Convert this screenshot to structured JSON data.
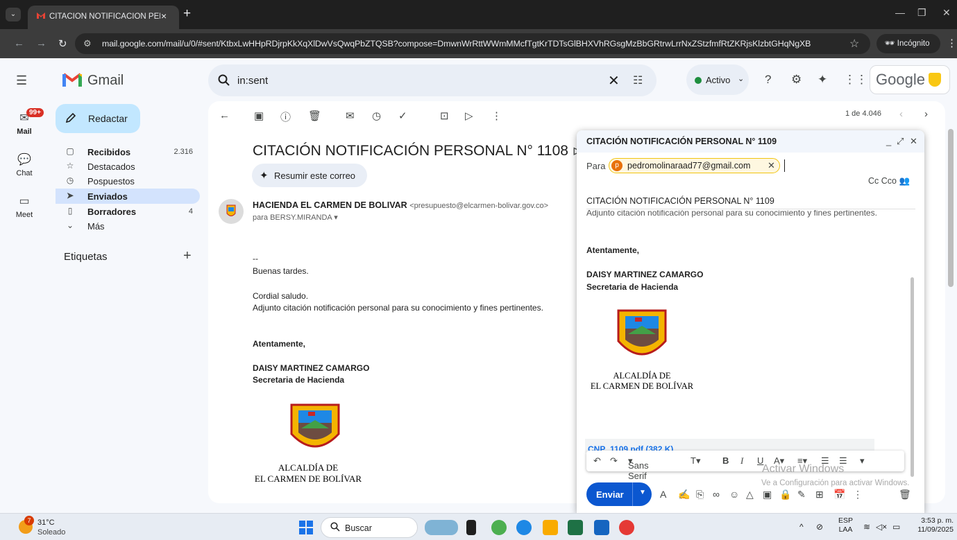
{
  "browser": {
    "tab_title": "CITACIÓN NOTIFICACIÓN PERSONAL",
    "tab_close": "×",
    "new_tab": "+",
    "url": "mail.google.com/mail/u/0/#sent/KtbxLwHHpRDjrpKkXqXlDwVsQwqPbZTQSB?compose=DmwnWrRttWWmMMcfTgtKrTDTsGlBHXVhRGsgMzBbGRtrwLrrNxZStzfmfRtZKRjsKlzbtGHqNgXB",
    "incognito_label": "Incógnito"
  },
  "gmail": {
    "brand": "Gmail",
    "compose_label": "Redactar",
    "rail": {
      "mail_label": "Mail",
      "mail_badge": "99+",
      "chat_label": "Chat",
      "meet_label": "Meet"
    },
    "nav": [
      {
        "label": "Recibidos",
        "count": "2.316"
      },
      {
        "label": "Destacados",
        "count": ""
      },
      {
        "label": "Pospuestos",
        "count": ""
      },
      {
        "label": "Enviados",
        "count": ""
      },
      {
        "label": "Borradores",
        "count": "4"
      },
      {
        "label": "Más",
        "count": ""
      }
    ],
    "labels_heading": "Etiquetas",
    "search_query": "in:sent",
    "status_label": "Activo",
    "google_label": "Google",
    "page_count": "1 de 4.046"
  },
  "email": {
    "subject": "CITACIÓN NOTIFICACIÓN PERSONAL N° 1108",
    "summarize_label": "Resumir este correo",
    "sender_name": "HACIENDA EL CARMEN DE BOLIVAR",
    "sender_email": "<presupuesto@elcarmen-bolivar.gov.co>",
    "to_line": "para BERSY.MIRANDA",
    "signature_dash": "--",
    "greeting": "Buenas tardes.",
    "regards": "Cordial saludo.",
    "body": "Adjunto citación notificación personal para su conocimiento y fines pertinentes.",
    "closing": "Atentamente,",
    "signer_name": "DAISY MARTINEZ CAMARGO",
    "signer_role": "Secretaria de Hacienda",
    "logo_line1": "ALCALDÍA DE",
    "logo_line2": "EL CARMEN DE BOLÍVAR"
  },
  "compose": {
    "title": "CITACIÓN NOTIFICACIÓN PERSONAL N° 1109",
    "to_label": "Para",
    "recipient_initial": "p",
    "recipient": "pedromolinaraad77@gmail.com",
    "cc_label": "Cc Cco",
    "subject": "CITACIÓN NOTIFICACIÓN PERSONAL N° 1109",
    "body_cut": "Adjunto citación notificación personal para su conocimiento y fines pertinentes.",
    "closing": "Atentamente,",
    "signer_name": "DAISY MARTINEZ CAMARGO",
    "signer_role": "Secretaria de Hacienda",
    "logo_line1": "ALCALDÍA DE",
    "logo_line2": "EL CARMEN DE BOLÍVAR",
    "attachment": "CNP_1109.pdf (382 K)",
    "font_label": "Sans Serif",
    "send_label": "Enviar"
  },
  "watermark": {
    "line1": "Activar Windows",
    "line2": "Ve a Configuración para activar Windows."
  },
  "taskbar": {
    "weather_badge": "7",
    "temperature": "31°C",
    "condition": "Soleado",
    "search_label": "Buscar",
    "lang_top": "ESP",
    "lang_bottom": "LAA",
    "time": "3:53 p. m.",
    "date": "11/09/2025"
  }
}
